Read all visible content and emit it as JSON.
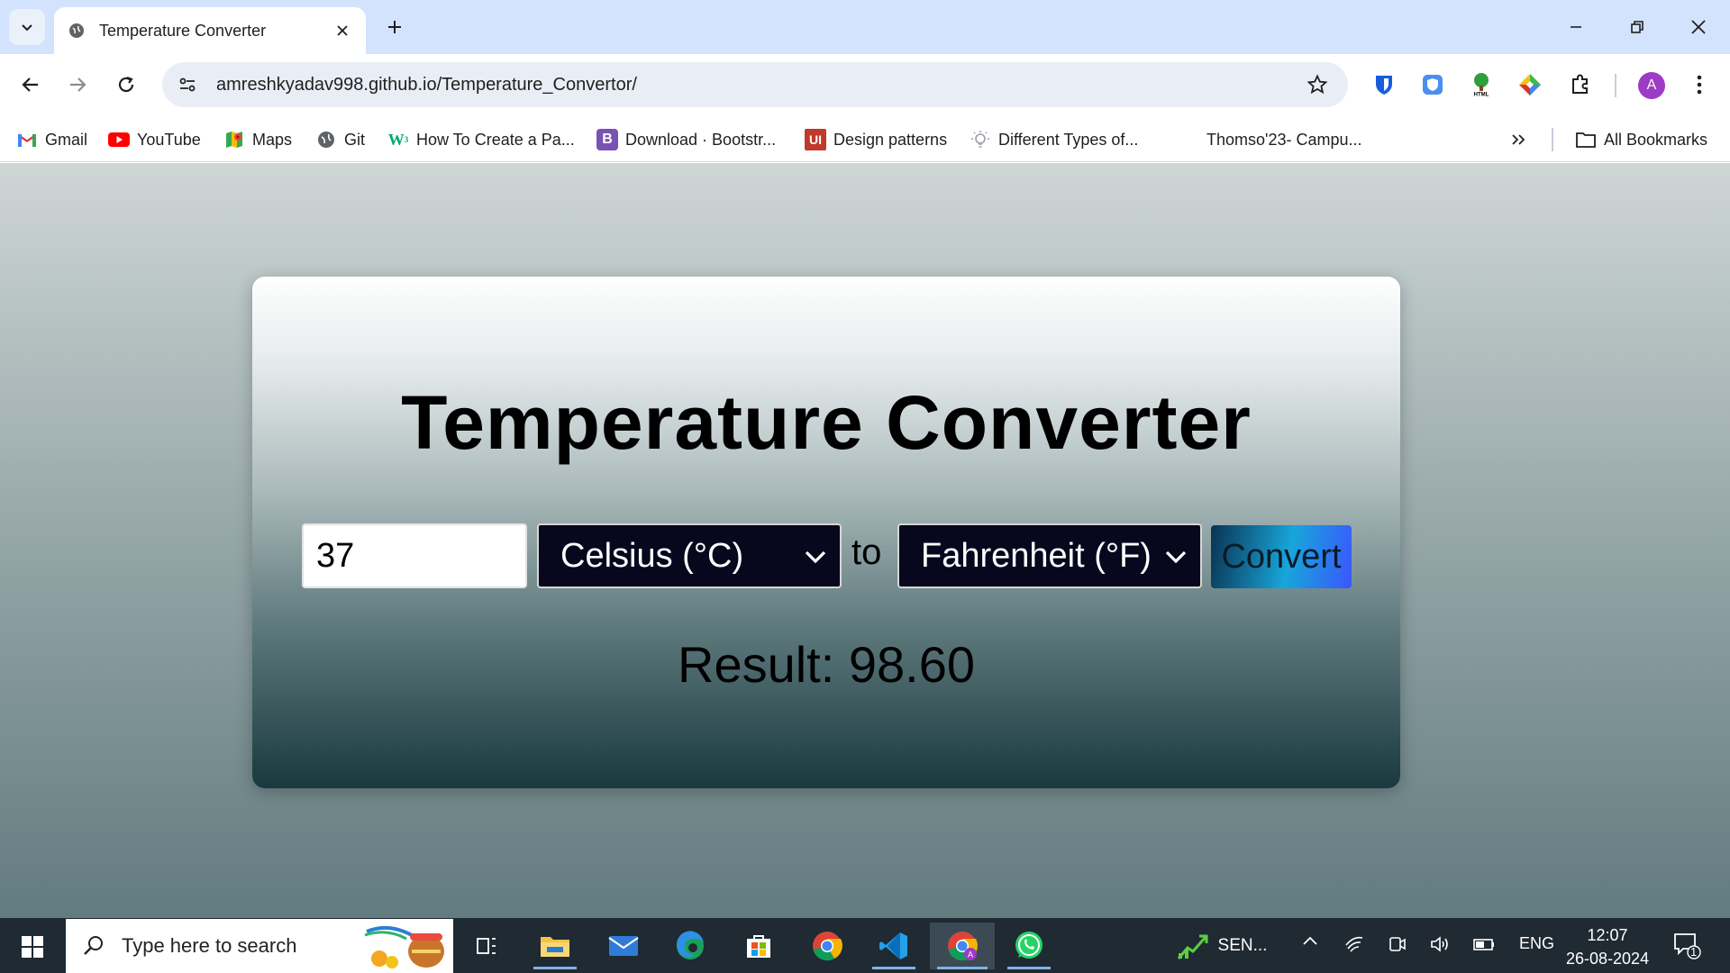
{
  "browser": {
    "tab_title": "Temperature Converter",
    "url": "amreshkyadav998.github.io/Temperature_Convertor/",
    "avatar_letter": "A"
  },
  "bookmarks": [
    {
      "label": "Gmail",
      "icon": "gmail-icon"
    },
    {
      "label": "YouTube",
      "icon": "youtube-icon"
    },
    {
      "label": "Maps",
      "icon": "maps-icon"
    },
    {
      "label": "Git",
      "icon": "globe-icon"
    },
    {
      "label": "How To Create a Pa...",
      "icon": "w3schools-icon"
    },
    {
      "label": "Download · Bootstr...",
      "icon": "bootstrap-icon"
    },
    {
      "label": "Design patterns",
      "icon": "ui-icon"
    },
    {
      "label": "Different Types of...",
      "icon": "bulb-icon"
    },
    {
      "label": "Thomso'23- Campu...",
      "icon": ""
    },
    {
      "label": "All Bookmarks",
      "icon": "folder-icon"
    }
  ],
  "page": {
    "title": "Temperature Converter",
    "input_value": "37",
    "from_unit": "Celsius (°C)",
    "connector": "to",
    "to_unit": "Fahrenheit (°F)",
    "convert_label": "Convert",
    "result": "Result: 98.60"
  },
  "taskbar": {
    "search_placeholder": "Type here to search",
    "stock_label": "SEN...",
    "language": "ENG",
    "time": "12:07",
    "date": "26-08-2024",
    "notification_count": "1"
  },
  "colors": {
    "tabstrip": "#d3e3fd",
    "select_bg": "#07071e",
    "taskbar": "#1f2a33"
  }
}
